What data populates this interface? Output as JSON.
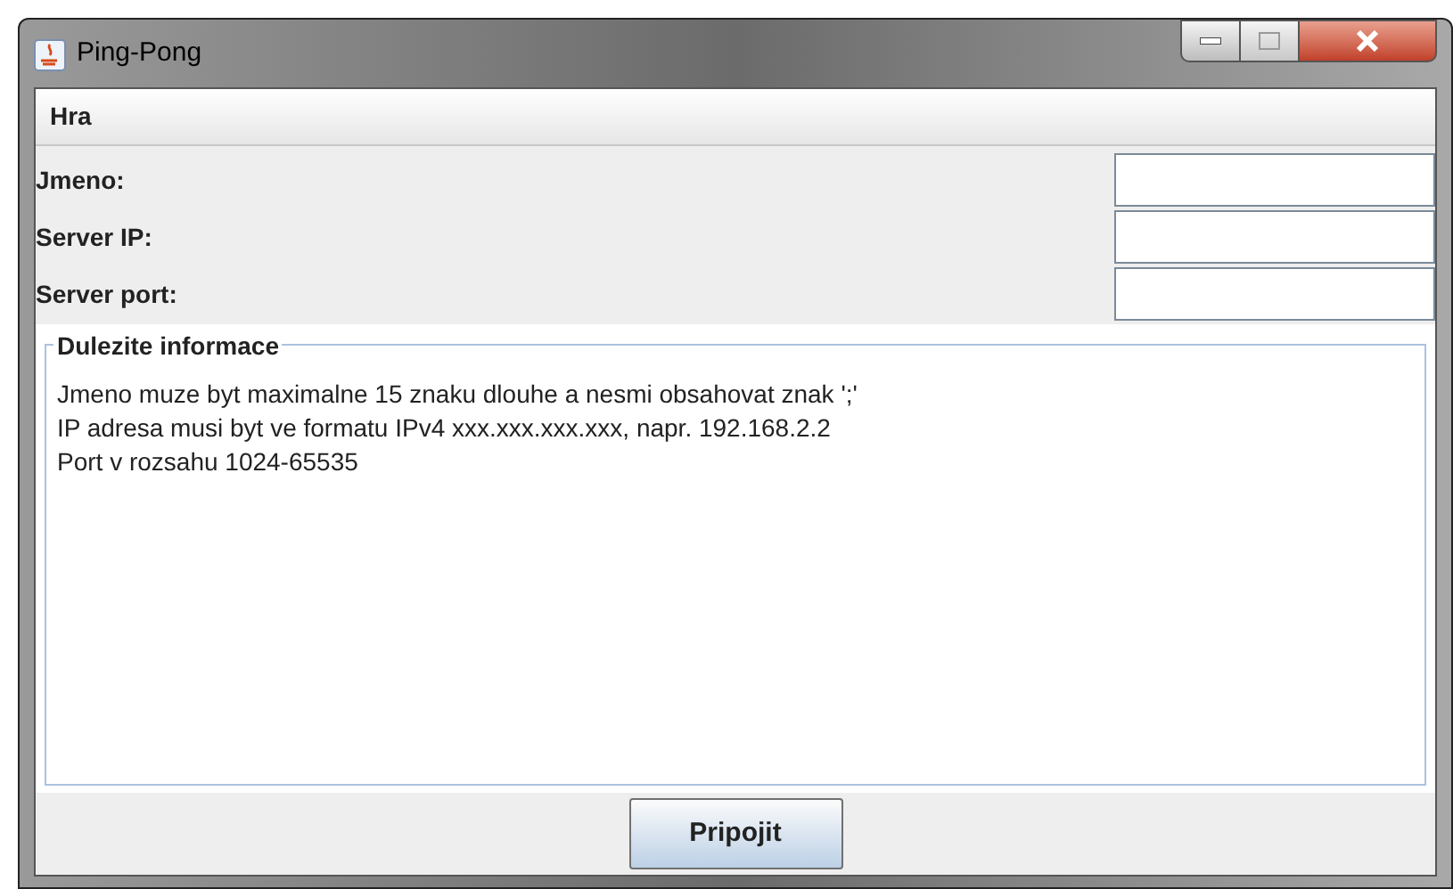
{
  "window": {
    "title": "Ping-Pong"
  },
  "menu": [
    {
      "label": "Hra"
    }
  ],
  "fields": [
    {
      "label": "Jmeno:"
    },
    {
      "label": "Server IP:"
    },
    {
      "label": "Server port:"
    }
  ],
  "info": {
    "title": "Dulezite informace",
    "lines": [
      "Jmeno muze byt maximalne 15 znaku dlouhe a nesmi obsahovat znak ';'",
      "IP adresa musi byt ve formatu IPv4 xxx.xxx.xxx.xxx, napr. 192.168.2.2",
      "Port v rozsahu 1024-65535"
    ]
  },
  "buttons": [
    "Pripojit"
  ]
}
